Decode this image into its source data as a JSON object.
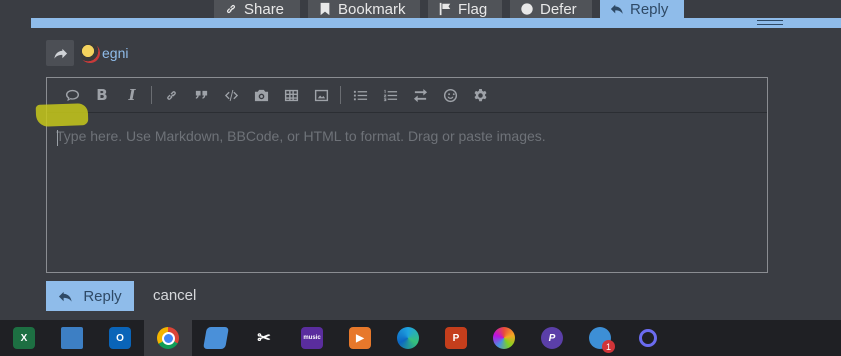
{
  "actions": {
    "share": "Share",
    "bookmark": "Bookmark",
    "flag": "Flag",
    "defer": "Defer",
    "reply": "Reply"
  },
  "reply_to": {
    "username": "egni"
  },
  "toolbar": {
    "buttons": [
      "quote",
      "bold",
      "italic",
      "link",
      "blockquote",
      "preformatted",
      "upload",
      "table",
      "image",
      "bulleted-list",
      "numbered-list",
      "toggle-direction",
      "emoji",
      "options"
    ]
  },
  "editor": {
    "placeholder": "Type here. Use Markdown, BBCode, or HTML to format. Drag or paste images."
  },
  "footer": {
    "reply_label": "Reply",
    "cancel_label": "cancel"
  },
  "taskbar": {
    "apps": [
      "excel",
      "remote-desktop",
      "outlook",
      "chrome",
      "app-blue",
      "snipping-tool",
      "amazon-music",
      "media-app",
      "edge",
      "powerpoint",
      "photos",
      "pixel-app",
      "notification-app",
      "cortana"
    ],
    "active": "chrome",
    "badge_count": "1"
  },
  "colors": {
    "accent": "#8fbcea",
    "background": "#3a3d43",
    "highlight": "#c7c81a"
  }
}
